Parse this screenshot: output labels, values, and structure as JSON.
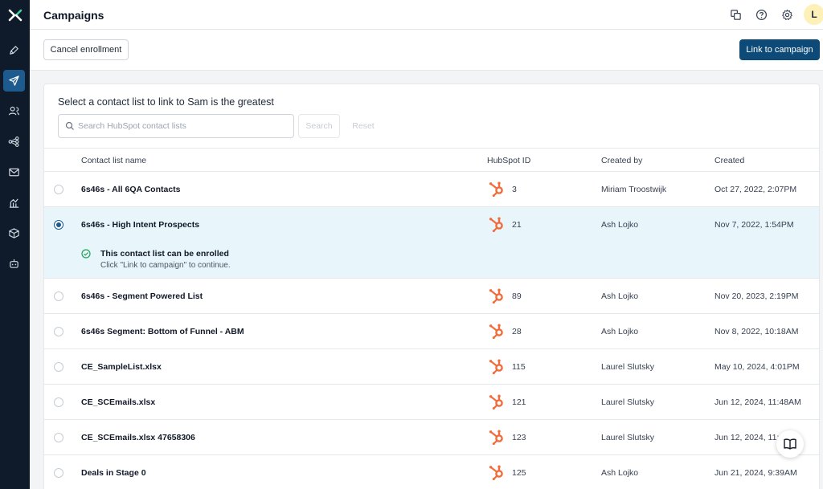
{
  "header": {
    "title": "Campaigns",
    "avatar_initial": "L"
  },
  "toolbar": {
    "cancel_label": "Cancel enrollment",
    "link_label": "Link to campaign"
  },
  "card": {
    "title": "Select a contact list to link to Sam is the greatest",
    "search_placeholder": "Search HubSpot contact lists",
    "search_label": "Search",
    "reset_label": "Reset"
  },
  "columns": {
    "name": "Contact list name",
    "hubspot_id": "HubSpot ID",
    "created_by": "Created by",
    "created": "Created"
  },
  "rows": [
    {
      "name": "6s46s - All 6QA Contacts",
      "hubspot_id": "3",
      "created_by": "Miriam Troostwijk",
      "created": "Oct 27, 2022, 2:07PM",
      "selected": false
    },
    {
      "name": "6s46s - High Intent Prospects",
      "hubspot_id": "21",
      "created_by": "Ash Lojko",
      "created": "Nov 7, 2022, 1:54PM",
      "selected": true
    },
    {
      "name": "6s46s - Segment Powered List",
      "hubspot_id": "89",
      "created_by": "Ash Lojko",
      "created": "Nov 20, 2023, 2:19PM",
      "selected": false
    },
    {
      "name": "6s46s Segment: Bottom of Funnel - ABM",
      "hubspot_id": "28",
      "created_by": "Ash Lojko",
      "created": "Nov 8, 2022, 10:18AM",
      "selected": false
    },
    {
      "name": "CE_SampleList.xlsx",
      "hubspot_id": "115",
      "created_by": "Laurel Slutsky",
      "created": "May 10, 2024, 4:01PM",
      "selected": false
    },
    {
      "name": "CE_SCEmails.xlsx",
      "hubspot_id": "121",
      "created_by": "Laurel Slutsky",
      "created": "Jun 12, 2024, 11:48AM",
      "selected": false
    },
    {
      "name": "CE_SCEmails.xlsx 47658306",
      "hubspot_id": "123",
      "created_by": "Laurel Slutsky",
      "created": "Jun 12, 2024, 11:",
      "selected": false
    },
    {
      "name": "Deals in Stage 0",
      "hubspot_id": "125",
      "created_by": "Ash Lojko",
      "created": "Jun 21, 2024, 9:39AM",
      "selected": false
    }
  ],
  "notice": {
    "title": "This contact list can be enrolled",
    "subtitle": "Click \"Link to campaign\" to continue."
  },
  "colors": {
    "sidebar": "#0f1b2a",
    "accent": "#0d4a78",
    "hubspot": "#f26b3a",
    "selected_row": "#e8f6fb",
    "success": "#22a35a"
  }
}
